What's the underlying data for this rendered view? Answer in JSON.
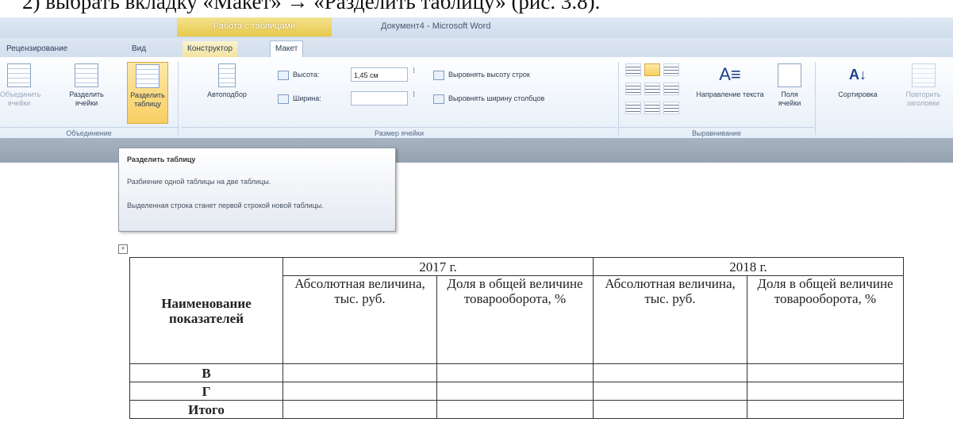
{
  "document": {
    "heading_fragment": "2) выбрать вкладку «Макет» → «Разделить таблицу» (рис. 3.8)."
  },
  "titlebar": {
    "context_group": "Работа с таблицами",
    "window_title": "Документ4 - Microsoft Word"
  },
  "tabs": [
    {
      "label": "Рецензирование"
    },
    {
      "label": "Вид"
    },
    {
      "label": "Конструктор"
    },
    {
      "label": "Макет"
    }
  ],
  "ribbon": {
    "merge": {
      "merge_cells": "Объединить ячейки",
      "split_cells": "Разделить ячейки",
      "split_table": "Разделить таблицу",
      "group_label": "Объединение"
    },
    "autofit": "Автоподбор",
    "cell_size": {
      "height_label": "Высота:",
      "height_value": "1,45 см",
      "width_label": "Ширина:",
      "width_value": "",
      "distribute_rows": "Выровнять высоту строк",
      "distribute_cols": "Выровнять ширину столбцов",
      "group_label": "Размер ячейки"
    },
    "alignment": {
      "text_direction": "Направление текста",
      "cell_margins": "Поля ячейки",
      "group_label": "Выравнивание"
    },
    "sort": "Сортировка",
    "repeat_header": "Повторить заголовки"
  },
  "tooltip": {
    "title": "Разделить таблицу",
    "line1": "Разбиение одной таблицы на две таблицы.",
    "line2": "Выделенная строка станет первой строкой новой таблицы."
  },
  "table": {
    "row_header": "Наименование показателей",
    "year1": "2017 г.",
    "year2": "2018 г.",
    "abs_label": "Абсолютная величина, тыс. руб.",
    "share_label": "Доля в общей величине товарооборота, %",
    "rows": [
      "В",
      "Г",
      "Итого"
    ]
  }
}
